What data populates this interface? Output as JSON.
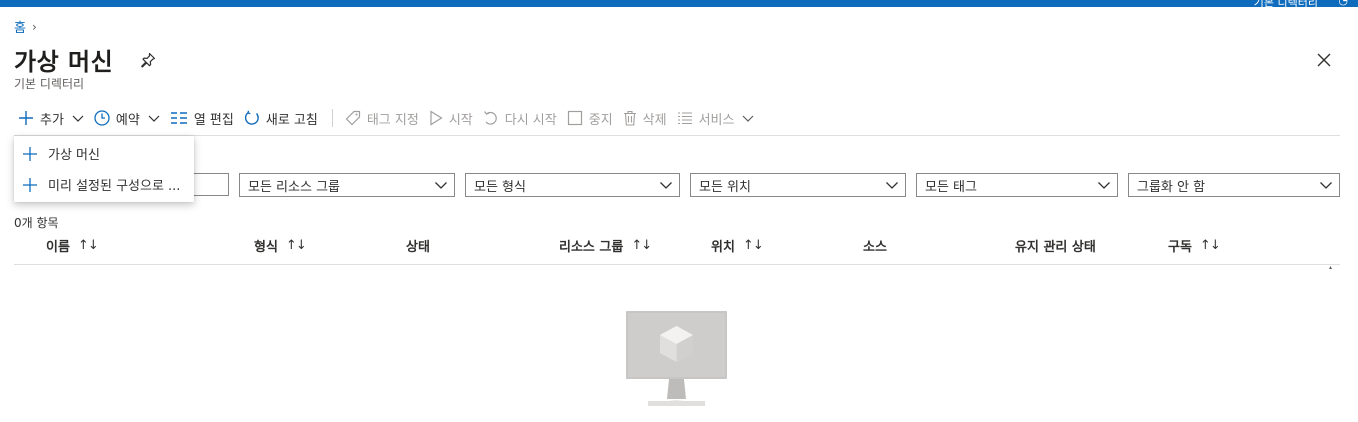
{
  "topbar": {
    "text": "기본 디렉터리"
  },
  "breadcrumb": {
    "home": "홈"
  },
  "page": {
    "title": "가상 머신",
    "subtitle": "기본 디렉터리"
  },
  "toolbar": {
    "add": "추가",
    "schedule": "예약",
    "edit_columns": "열 편집",
    "refresh": "새로 고침",
    "assign_tags": "태그 지정",
    "start": "시작",
    "restart": "다시 시작",
    "stop": "중지",
    "delete": "삭제",
    "services": "서비스"
  },
  "add_menu": {
    "items": [
      {
        "label": "가상 머신"
      },
      {
        "label": "미리 설정된 구성으로 ..."
      }
    ]
  },
  "filters": {
    "resource_group": "모든 리소스 그룹",
    "type": "모든 형식",
    "location": "모든 위치",
    "tags": "모든 태그",
    "grouping": "그룹화 안 함"
  },
  "list": {
    "count_text": "0개 항목",
    "columns": [
      {
        "label": "이름",
        "sortable": true
      },
      {
        "label": "형식",
        "sortable": true
      },
      {
        "label": "상태",
        "sortable": false
      },
      {
        "label": "리소스 그룹",
        "sortable": true
      },
      {
        "label": "위치",
        "sortable": true
      },
      {
        "label": "소스",
        "sortable": false
      },
      {
        "label": "유지 관리 상태",
        "sortable": false
      },
      {
        "label": "구독",
        "sortable": true
      }
    ],
    "rows": []
  },
  "theme": {
    "accent": "#0f6cbd",
    "disabled": "#a19f9d",
    "border": "#8a8886"
  },
  "icons": {
    "add": "plus-icon",
    "schedule": "clock-icon",
    "columns": "columns-icon",
    "refresh": "refresh-icon",
    "tag": "tag-icon",
    "start": "play-icon",
    "restart": "restart-icon",
    "stop": "stop-icon",
    "delete": "trash-icon",
    "services": "list-icon",
    "pin": "pin-icon",
    "close": "close-icon"
  }
}
